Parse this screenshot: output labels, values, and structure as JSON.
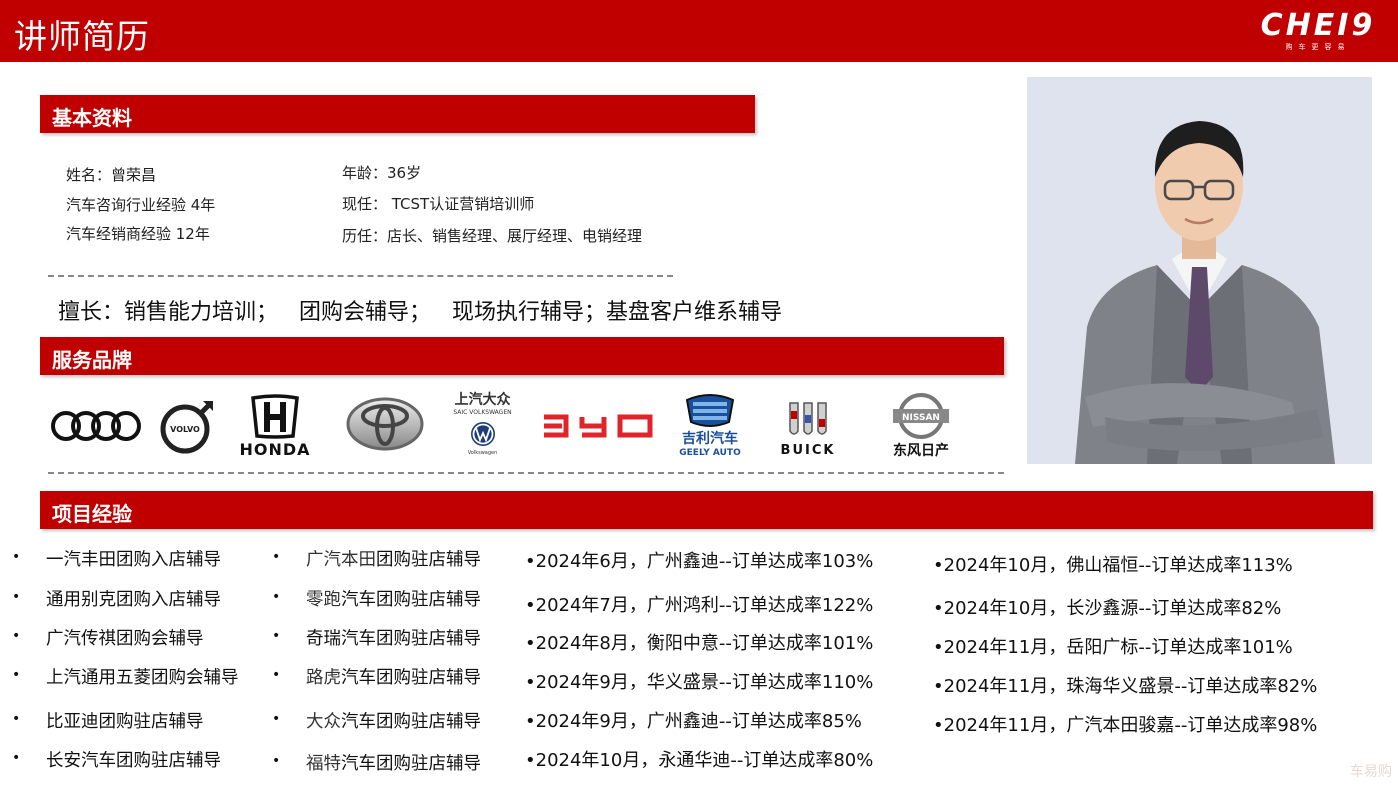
{
  "header": {
    "title": "讲师简历",
    "logo_word": "CHEI9",
    "logo_tag": "购车更容易"
  },
  "sections": {
    "basic": "基本资料",
    "brands": "服务品牌",
    "projects": "项目经验"
  },
  "basic_info": {
    "left": [
      "姓名：曾荣昌",
      "汽车咨询行业经验 4年",
      "汽车经销商经验 12年"
    ],
    "right": [
      "年龄：36岁",
      "现任： TCST认证营销培训师",
      "历任：店长、销售经理、展厅经理、电销经理"
    ]
  },
  "strength": "擅长：销售能力培训；   团购会辅导；   现场执行辅导；基盘客户维系辅导",
  "brands": {
    "honda": "HONDA",
    "saic_vw_cn": "上汽大众",
    "saic_vw_en": "SAIC VOLKSWAGEN",
    "vw_small": "Volkswagen",
    "geely_cn": "吉利汽车",
    "geely_en": "GEELY AUTO",
    "buick": "BUICK",
    "nissan_badge": "NISSAN",
    "nissan_cn": "东风日产",
    "volvo": "VOLVO"
  },
  "projects": {
    "col1": [
      "一汽丰田团购入店辅导",
      "通用别克团购入店辅导",
      "广汽传祺团购会辅导",
      "上汽通用五菱团购会辅导",
      "比亚迪团购驻店辅导",
      "长安汽车团购驻店辅导"
    ],
    "col2_prefix": [
      "广汽本田",
      "零跑",
      "奇瑞",
      "路虎",
      "大众",
      "福特"
    ],
    "col2_suffix": [
      "团购驻店辅导",
      "汽车团购驻店辅导",
      "汽车团购驻店辅导",
      "汽车团购驻店辅导",
      "汽车团购驻店辅导",
      "汽车团购驻店辅导"
    ],
    "col3": [
      "•2024年6月，广州鑫迪--订单达成率103%",
      "•2024年7月，广州鸿利--订单达成率122%",
      "•2024年8月，衡阳中意--订单达成率101%",
      "•2024年9月，华义盛景--订单达成率110%",
      "•2024年9月，广州鑫迪--订单达成率85%",
      "•2024年10月，永通华迪--订单达成率80%"
    ],
    "col4": [
      "•2024年10月，佛山福恒--订单达成率113%",
      "•2024年10月，长沙鑫源--订单达成率82%",
      "•2024年11月，岳阳广标--订单达成率101%",
      "•2024年11月，珠海华义盛景--订单达成率82%",
      "•2024年11月，广汽本田骏嘉--订单达成率98%"
    ],
    "bullet": "•"
  },
  "watermark": "车易购",
  "colors": {
    "brand_red": "#c00000",
    "byd_red": "#e0242a",
    "geely_blue": "#1a4f9c"
  }
}
